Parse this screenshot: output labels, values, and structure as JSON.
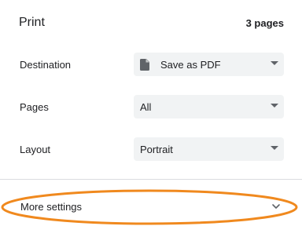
{
  "header": {
    "title": "Print",
    "page_count": "3 pages"
  },
  "settings": {
    "destination": {
      "label": "Destination",
      "value": "Save as PDF",
      "icon": "file-icon"
    },
    "pages": {
      "label": "Pages",
      "value": "All"
    },
    "layout": {
      "label": "Layout",
      "value": "Portrait"
    }
  },
  "more_settings": {
    "label": "More settings",
    "icon": "chevron-down-icon"
  },
  "colors": {
    "highlight": "#f0891e",
    "select_bg": "#f1f3f4",
    "text": "#202124",
    "divider": "#dadce0"
  }
}
